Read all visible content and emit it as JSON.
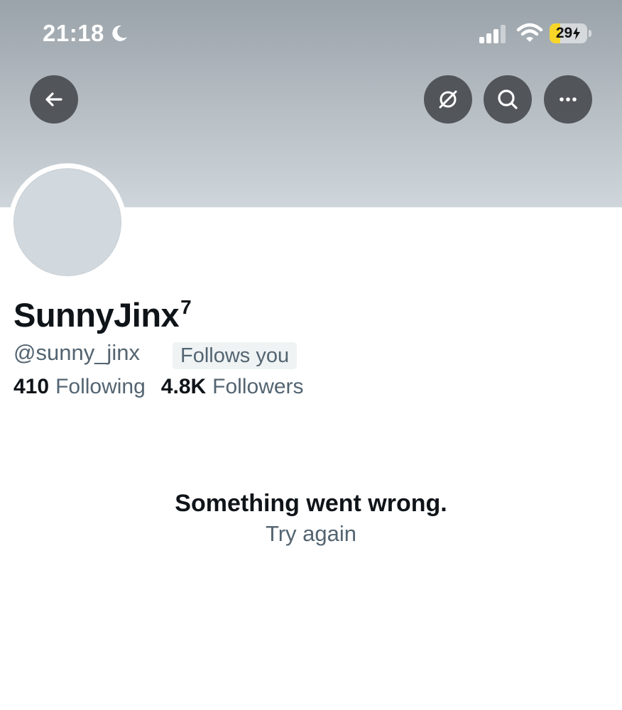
{
  "status_bar": {
    "time": "21:18",
    "battery_level": "29",
    "battery_fraction": 0.29,
    "icons": [
      "moon-icon",
      "signal-icon",
      "wifi-icon",
      "charging-icon"
    ]
  },
  "header": {
    "buttons": [
      "back-arrow-icon",
      "hide-eye-slash-icon",
      "search-icon",
      "more-horizontal-icon"
    ]
  },
  "profile": {
    "display_name": "SunnyJinx",
    "name_superscript": "7",
    "handle": "@sunny_jinx",
    "follows_you_badge": "Follows you",
    "following_count": "410",
    "following_label": "Following",
    "followers_count": "4.8K",
    "followers_label": "Followers"
  },
  "error": {
    "title": "Something went wrong.",
    "retry_label": "Try again"
  },
  "colors": {
    "primary_text": "#0f1419",
    "secondary_text": "#536471",
    "badge_bg": "#eff3f4",
    "avatar_placeholder": "#d2d9de",
    "battery_charging": "#f8d629"
  }
}
